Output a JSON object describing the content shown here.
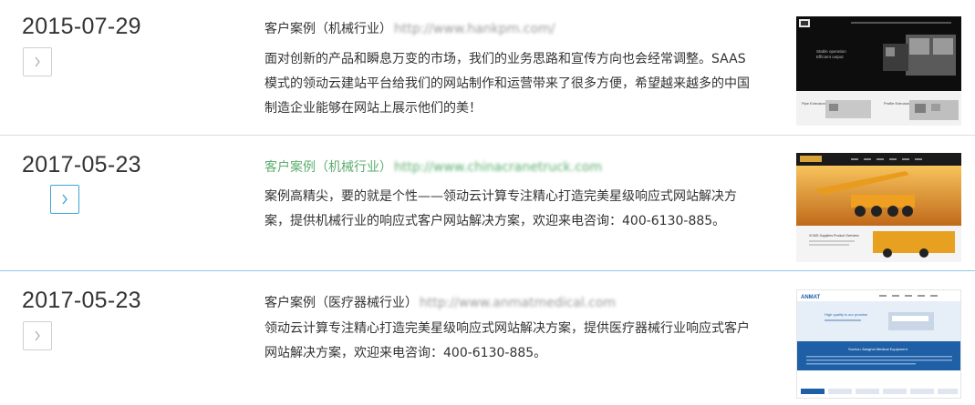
{
  "cases": [
    {
      "date": "2015-07-29",
      "title": "客户案例（机械行业）",
      "url": "http://www.hankpm.com/",
      "description": "面对创新的产品和瞬息万变的市场，我们的业务思路和宣传方向也会经常调整。SAAS模式的领动云建站平台给我们的网站制作和运营带来了很多方便，希望越来越多的中国制造企业能够在网站上展示他们的美！",
      "thumb_text": [
        "Stable operation",
        "Efficient output",
        "Pipe Extrusion Line",
        "Profile Extrusion Line"
      ]
    },
    {
      "date": "2017-05-23",
      "title": "客户案例（机械行业）",
      "url": "http://www.chinacranetruck.com",
      "description": "案例高精尖，要的就是个性——领动云计算专注精心打造完美星级响应式网站解决方案，提供机械行业的响应式客户网站解决方案，欢迎来电咨询：400-6130-885。",
      "thumb_text": [
        "XCMG Suppliers Product Overview"
      ]
    },
    {
      "date": "2017-05-23",
      "title": "客户案例（医疗器械行业）",
      "url": "http://www.anmatmedical.com",
      "description": "领动云计算专注精心打造完美星级响应式网站解决方案，提供医疗器械行业响应式客户网站解决方案，欢迎来电咨询：400-6130-885。",
      "thumb_text": [
        "ANMAT",
        "High quality is our promise",
        "Suzhou Jianghai Medical Equipment"
      ]
    }
  ],
  "icons": {
    "arrow": "chevron-right-icon"
  },
  "colors": {
    "accent": "#3ea6d9",
    "link_green": "#5cae6e",
    "divider": "#dcdcdc"
  }
}
